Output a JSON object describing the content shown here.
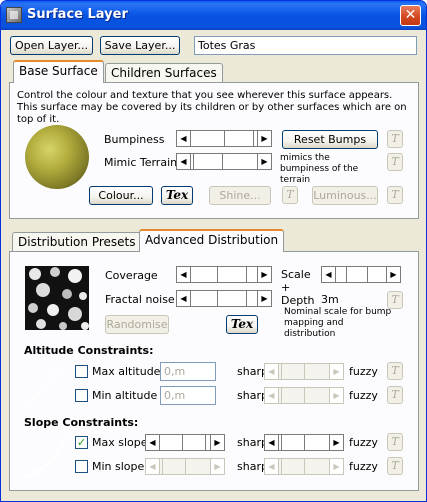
{
  "window": {
    "title": "Surface Layer",
    "close_glyph": "✕",
    "icon": "surface-layer-icon"
  },
  "toolbar": {
    "open_label": "Open Layer...",
    "save_label": "Save Layer...",
    "name_value": "Totes Gras"
  },
  "tabs_top": {
    "base_surface": "Base Surface",
    "children_surfaces": "Children Surfaces"
  },
  "base": {
    "description": "Control the colour and texture that you see wherever this surface appears. This surface may be covered by its children or by other surfaces which are on top of it.",
    "bumpiness_label": "Bumpiness",
    "mimic_label": "Mimic Terrain",
    "reset_bumps_label": "Reset Bumps",
    "mimic_note": "mimics the bumpiness of the terrain",
    "colour_label": "Colour...",
    "tex_label": "Tex",
    "shine_label": "Shine...",
    "luminous_label": "Luminous...",
    "i_label": "T",
    "bumpiness_level": 0.55,
    "mimic_level": 0.1
  },
  "tabs_bottom": {
    "distribution_presets": "Distribution Presets",
    "advanced_distribution": "Advanced Distribution"
  },
  "advanced": {
    "coverage_label": "Coverage",
    "fractal_label": "Fractal noise",
    "randomise_label": "Randomise",
    "tex_label": "Tex",
    "scale_label": "Scale + Depth",
    "scale_value": "3m",
    "scale_note": "Nominal scale for bump mapping and distribution",
    "altitude_title": "Altitude Constraints:",
    "max_altitude_label": "Max altitude",
    "max_altitude_value": "0,m",
    "min_altitude_label": "Min altitude",
    "min_altitude_value": "0,m",
    "slope_title": "Slope Constraints:",
    "max_slope_label": "Max slope",
    "min_slope_label": "Min slope",
    "sharp_label": "sharp",
    "fuzzy_label": "fuzzy",
    "check_glyph": "✓",
    "i_label": "T"
  },
  "colors": {
    "titlebar": "#0a53e0",
    "face": "#ece9d8",
    "tab_active_accent": "#e68b2c"
  }
}
